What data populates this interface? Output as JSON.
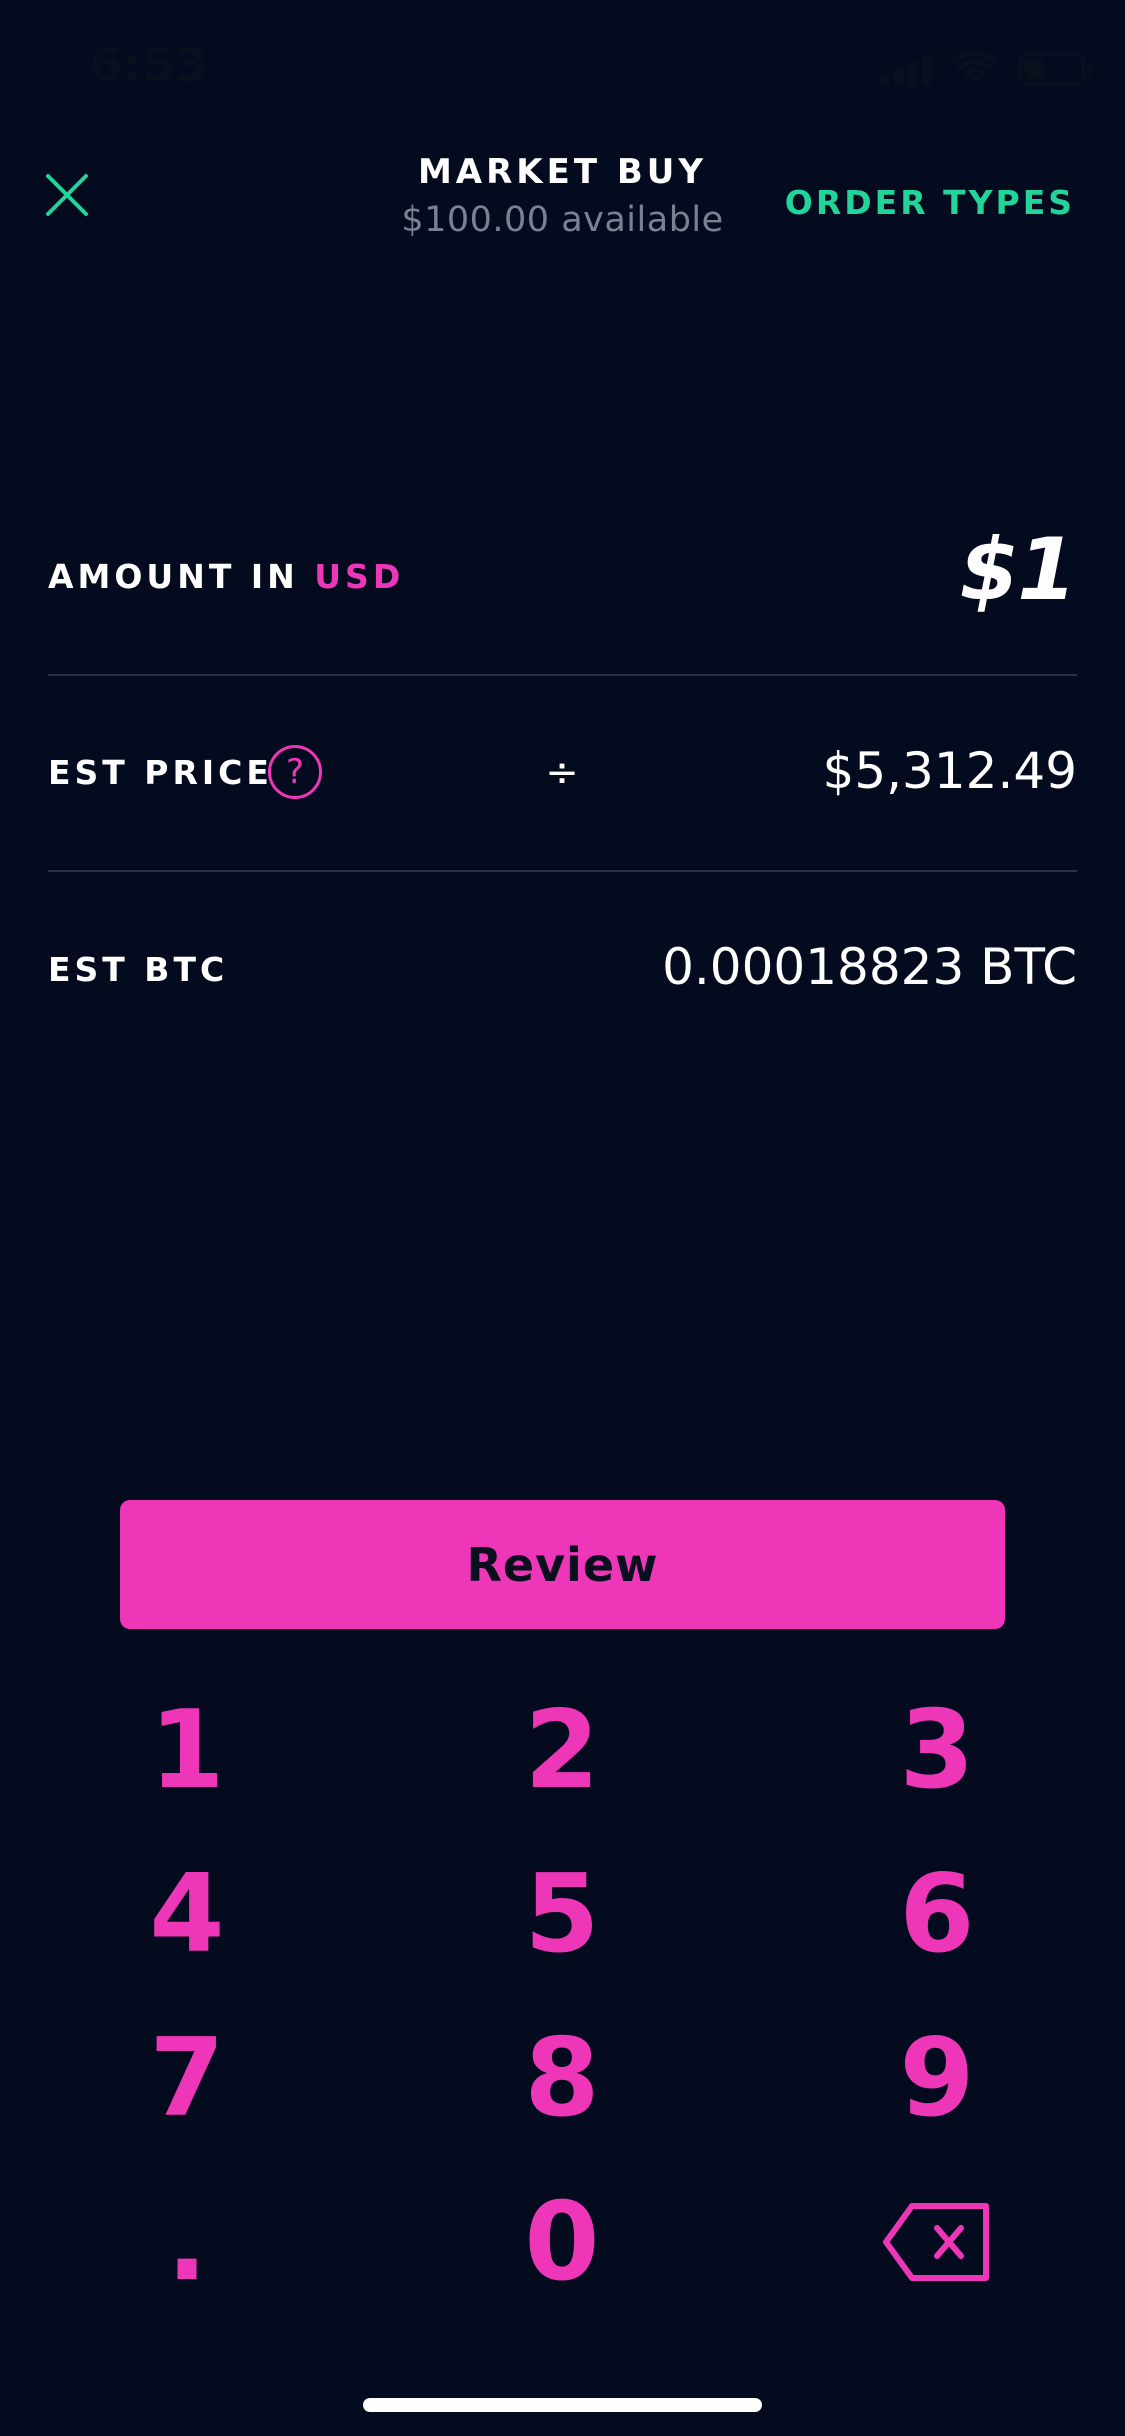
{
  "status_bar": {
    "time": "6:53",
    "battery_level": 0.35
  },
  "header": {
    "title": "MARKET BUY",
    "subtitle": "$100.00 available",
    "order_types_label": "ORDER TYPES"
  },
  "rows": {
    "amount_label": "AMOUNT IN",
    "amount_currency": "USD",
    "amount_value": "$1",
    "est_price_label": "EST PRICE",
    "help_symbol": "?",
    "operator_symbol": "÷",
    "est_price_value": "$5,312.49",
    "est_btc_label": "EST BTC",
    "est_btc_value": "0.00018823 BTC"
  },
  "review_label": "Review",
  "keypad": {
    "keys": [
      "1",
      "2",
      "3",
      "4",
      "5",
      "6",
      "7",
      "8",
      "9",
      ".",
      "0"
    ],
    "backspace_icon": "backspace-icon"
  },
  "colors": {
    "background": "#050b1e",
    "accent_pink": "#ee36b8",
    "accent_green": "#22d49a",
    "muted_text": "#7b8191",
    "divider": "#2a3142"
  }
}
